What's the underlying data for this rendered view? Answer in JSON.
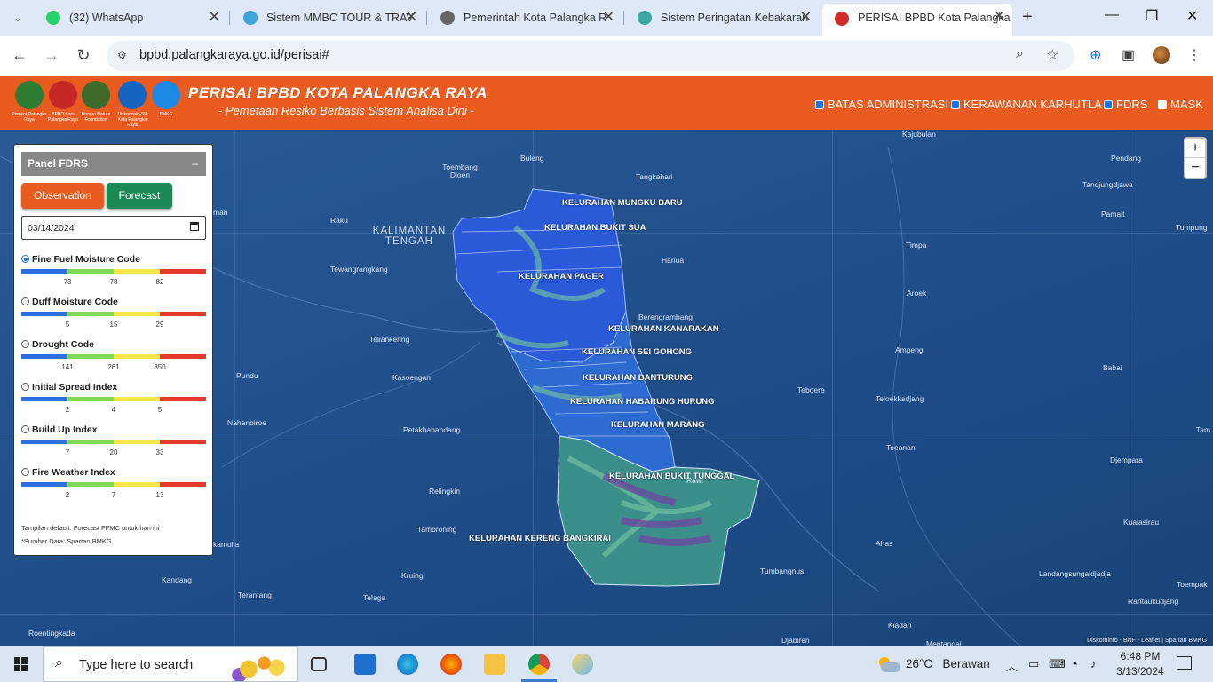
{
  "browser": {
    "tabs": [
      {
        "label": "(32) WhatsApp",
        "favicon": "whatsapp-icon",
        "color": "#25d366"
      },
      {
        "label": "Sistem MMBC TOUR & TRAV",
        "favicon": "globe-map-icon",
        "color": "#3ba7d8"
      },
      {
        "label": "Pemerintah Kota Palangka R",
        "favicon": "globe-icon",
        "color": "#555555"
      },
      {
        "label": "Sistem Peringatan Kebakaran",
        "favicon": "fire-warning-icon",
        "color": "#3aa9a0"
      },
      {
        "label": "PERISAI BPBD Kota Palangka",
        "favicon": "bpbd-icon",
        "color": "#d12b2b"
      }
    ],
    "url": "bpbd.palangkaraya.go.id/perisai#"
  },
  "app": {
    "title": "PERISAI BPBD KOTA PALANGKA RAYA",
    "subtitle": "- Pemetaan Resiko Berbasis Sistem Analisa Dini -",
    "logos": [
      {
        "caption": "Pemkot Palangka Raya",
        "color": "#2e7d32"
      },
      {
        "caption": "BPBD Kota Palangka Raya",
        "color": "#c62828"
      },
      {
        "caption": "Borneo Nature Foundation",
        "color": "#3e6b2a"
      },
      {
        "caption": "Diskominfo-SP Kota Palangka Raya",
        "color": "#1565c0"
      },
      {
        "caption": "BMKG",
        "color": "#1e88e5"
      }
    ],
    "layers": [
      {
        "label": "BATAS ADMINISTRASI",
        "checked": true
      },
      {
        "label": "KERAWANAN KARHUTLA",
        "checked": true
      },
      {
        "label": "FDRS",
        "checked": true
      },
      {
        "label": "MASK",
        "checked": false
      }
    ]
  },
  "panel": {
    "title": "Panel FDRS",
    "minimize": "–",
    "observation": "Observation",
    "forecast": "Forecast",
    "date": "03/14/2024",
    "indices": [
      {
        "name": "Fine Fuel Moisture Code",
        "selected": true,
        "ticks": [
          "73",
          "78",
          "82"
        ]
      },
      {
        "name": "Duff Moisture Code",
        "selected": false,
        "ticks": [
          "5",
          "15",
          "29"
        ]
      },
      {
        "name": "Drought Code",
        "selected": false,
        "ticks": [
          "141",
          "261",
          "350"
        ]
      },
      {
        "name": "Initial Spread Index",
        "selected": false,
        "ticks": [
          "2",
          "4",
          "5"
        ]
      },
      {
        "name": "Build Up Index",
        "selected": false,
        "ticks": [
          "7",
          "20",
          "33"
        ]
      },
      {
        "name": "Fire Weather Index",
        "selected": false,
        "ticks": [
          "2",
          "7",
          "13"
        ]
      }
    ],
    "scale_colors": [
      "#2f6fe0",
      "#7ed957",
      "#f6e84a",
      "#e23b2e"
    ],
    "note_default": "Tampilan default: Forecast FFMC untuk hari ini",
    "note_source": "*Sumber Data: Spartan BMKG"
  },
  "map": {
    "region": "KALIMANTAN TENGAH",
    "zoom_in": "+",
    "zoom_out": "−",
    "attribution": "Diskominfo - BNF - Leaflet | Spartan BMKG",
    "places": [
      "Kajubulan",
      "Toembang Djoen",
      "Buleng",
      "Tangkahari",
      "Pendang",
      "Tandjungdjawa",
      "Raku",
      "Pamalt",
      "Tumpung",
      "Timpa",
      "Hanua",
      "Tewangrangkang",
      "Aroek",
      "Berengrambang",
      "Teliankering",
      "Ampeng",
      "Kasoengan",
      "Babai",
      "Pundu",
      "Teboere",
      "Teloekkadjang",
      "Nahanbiroe",
      "Petakbahandang",
      "Toeanan",
      "Djempara",
      "Relingkin",
      "Rawi",
      "Kualasirau",
      "Tambroning",
      "Ahas",
      "Tumbangnus",
      "Kruing",
      "Landangsungaidjadja",
      "Toempak",
      "Kandang",
      "Terantang",
      "Telaga",
      "Rantaukudjang",
      "Roentingkada",
      "Kiadan",
      "Djabiren",
      "Mentangai",
      "kamulja",
      "man",
      "Tam"
    ],
    "kelurahan": [
      "KELURAHAN MUNGKU BARU",
      "KELURAHAN BUKIT SUA",
      "KELURAHAN PAGER",
      "KELURAHAN KANARAKAN",
      "KELURAHAN SEI GOHONG",
      "KELURAHAN BANTURUNG",
      "KELURAHAN HABARUNG HURUNG",
      "KELURAHAN MARANG",
      "KELURAHAN BUKIT TUNGGAL",
      "KELURAHAN KERENG BANGKIRAI"
    ]
  },
  "taskbar": {
    "search_placeholder": "Type here to search",
    "weather_temp": "26°C",
    "weather_desc": "Berawan",
    "time": "6:48 PM",
    "date": "3/13/2024"
  }
}
